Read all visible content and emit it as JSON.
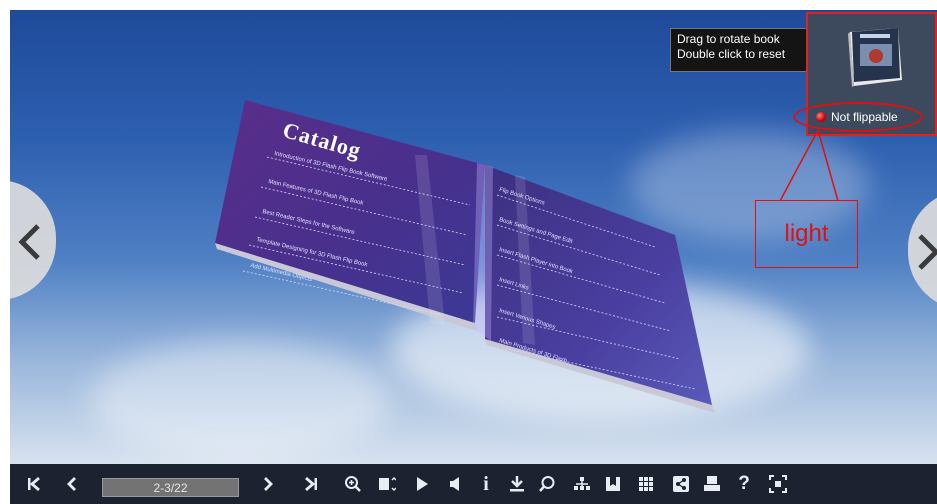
{
  "viewer": {
    "catalog_title": "Catalog",
    "left_page_lines": [
      "Introduction of 3D Flash Flip Book Software",
      "Main Features of 3D Flash Flip Book",
      "Best Reader Steps for the Software",
      "Template Designing for 3D Flash Flip Book",
      "Add Multimedia Objects"
    ],
    "right_page_lines": [
      "Flip Book Options",
      "Book Settings and Page Edit",
      "Insert Flash Player into Book",
      "Insert Links",
      "Insert Various Shapes",
      "Main Products of 3D Flash"
    ]
  },
  "tooltip": {
    "line1": "Drag to rotate book",
    "line2": "Double click to reset"
  },
  "thumbnail": {
    "status_label": "Not flippable",
    "indicator_color": "#e00000"
  },
  "annotation": {
    "callout_label": "light",
    "color": "#e01010"
  },
  "toolbar": {
    "page_indicator": "2-3/22",
    "icons": [
      "first-page-icon",
      "previous-page-icon",
      "next-page-icon",
      "last-page-icon",
      "zoom-in-icon",
      "thumbnails-icon",
      "autoplay-icon",
      "sound-icon",
      "info-icon",
      "download-icon",
      "search-icon",
      "table-of-contents-icon",
      "bookmark-icon",
      "grid-icon",
      "share-icon",
      "print-icon",
      "help-icon",
      "fullscreen-icon"
    ]
  }
}
